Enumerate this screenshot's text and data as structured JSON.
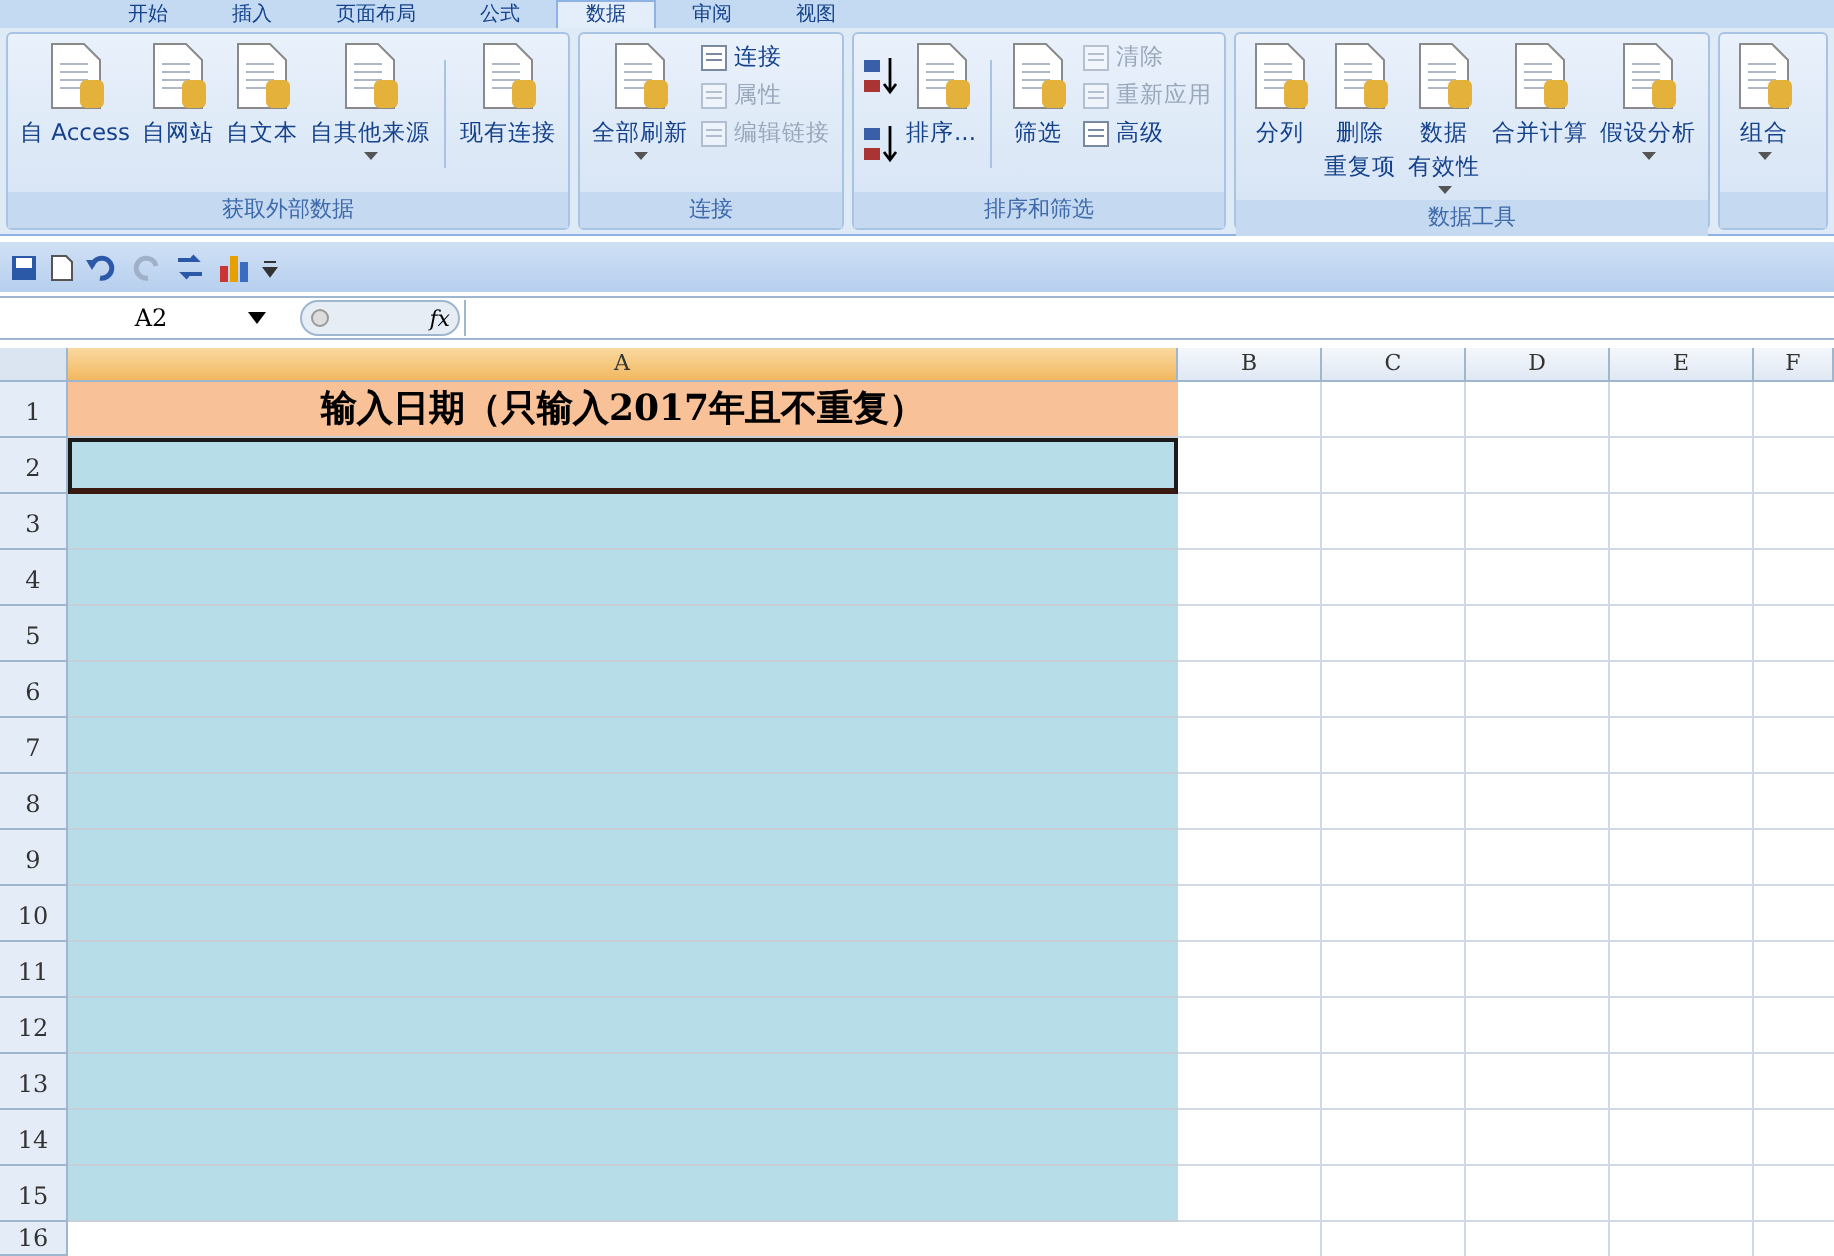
{
  "tabs": [
    {
      "label": "开始",
      "selected": false
    },
    {
      "label": "插入",
      "selected": false
    },
    {
      "label": "页面布局",
      "selected": false
    },
    {
      "label": "公式",
      "selected": false
    },
    {
      "label": "数据",
      "selected": true
    },
    {
      "label": "审阅",
      "selected": false
    },
    {
      "label": "视图",
      "selected": false
    }
  ],
  "ribbon_groups": [
    {
      "title": "获取外部数据",
      "items": [
        {
          "kind": "large",
          "lines": [
            "自 Access"
          ],
          "dropdown": false
        },
        {
          "kind": "large",
          "lines": [
            "自网站"
          ],
          "dropdown": false
        },
        {
          "kind": "large",
          "lines": [
            "自文本"
          ],
          "dropdown": false
        },
        {
          "kind": "large",
          "lines": [
            "自其他来源"
          ],
          "dropdown": true
        },
        {
          "kind": "separator"
        },
        {
          "kind": "large",
          "lines": [
            "现有连接"
          ],
          "dropdown": false
        }
      ]
    },
    {
      "title": "连接",
      "items": [
        {
          "kind": "large",
          "lines": [
            "全部刷新"
          ],
          "dropdown": true
        },
        {
          "kind": "stack",
          "buttons": [
            {
              "label": "连接",
              "disabled": false
            },
            {
              "label": "属性",
              "disabled": true
            },
            {
              "label": "编辑链接",
              "disabled": true
            }
          ]
        }
      ]
    },
    {
      "title": "排序和筛选",
      "items": [
        {
          "kind": "sortpair"
        },
        {
          "kind": "large",
          "lines": [
            "排序..."
          ],
          "dropdown": false
        },
        {
          "kind": "separator"
        },
        {
          "kind": "large",
          "lines": [
            "筛选"
          ],
          "dropdown": false
        },
        {
          "kind": "stack",
          "buttons": [
            {
              "label": "清除",
              "disabled": true
            },
            {
              "label": "重新应用",
              "disabled": true
            },
            {
              "label": "高级",
              "disabled": false
            }
          ]
        }
      ]
    },
    {
      "title": "数据工具",
      "items": [
        {
          "kind": "large",
          "lines": [
            "分列"
          ],
          "dropdown": false
        },
        {
          "kind": "large",
          "lines": [
            "删除",
            "重复项"
          ],
          "dropdown": false
        },
        {
          "kind": "large",
          "lines": [
            "数据",
            "有效性"
          ],
          "dropdown": true
        },
        {
          "kind": "large",
          "lines": [
            "合并计算"
          ],
          "dropdown": false
        },
        {
          "kind": "large",
          "lines": [
            "假设分析"
          ],
          "dropdown": true
        }
      ]
    },
    {
      "items": [
        {
          "kind": "large",
          "lines": [
            "组合"
          ],
          "dropdown": true
        }
      ]
    }
  ],
  "name_box": "A2",
  "fx": "fx",
  "columns": [
    {
      "label": "A",
      "selected": true
    },
    {
      "label": "B",
      "selected": false
    },
    {
      "label": "C",
      "selected": false
    },
    {
      "label": "D",
      "selected": false
    },
    {
      "label": "E",
      "selected": false
    },
    {
      "label": "F",
      "selected": false
    }
  ],
  "rows": [
    {
      "number": "1",
      "cell_a": {
        "text": "输入日期（只输入2017年且不重复）",
        "color": "#f9c197",
        "selected": false
      }
    },
    {
      "number": "2",
      "cell_a": {
        "color": "#b7dde8",
        "selected": true
      }
    },
    {
      "number": "3",
      "cell_a": {
        "color": "#b7dde8",
        "selected": false
      }
    },
    {
      "number": "4",
      "cell_a": {
        "color": "#b7dde8",
        "selected": false
      }
    },
    {
      "number": "5",
      "cell_a": {
        "color": "#b7dde8",
        "selected": false
      }
    },
    {
      "number": "6",
      "cell_a": {
        "color": "#b7dde8",
        "selected": false
      }
    },
    {
      "number": "7",
      "cell_a": {
        "color": "#b7dde8",
        "selected": false
      }
    },
    {
      "number": "8",
      "cell_a": {
        "color": "#b7dde8",
        "selected": false
      }
    },
    {
      "number": "9",
      "cell_a": {
        "color": "#b7dde8",
        "selected": false
      }
    },
    {
      "number": "10",
      "cell_a": {
        "color": "#b7dde8",
        "selected": false
      }
    },
    {
      "number": "11",
      "cell_a": {
        "color": "#b7dde8",
        "selected": false
      }
    },
    {
      "number": "12",
      "cell_a": {
        "color": "#b7dde8",
        "selected": false
      }
    },
    {
      "number": "13",
      "cell_a": {
        "color": "#b7dde8",
        "selected": false
      }
    },
    {
      "number": "14",
      "cell_a": {
        "color": "#b7dde8",
        "selected": false
      }
    },
    {
      "number": "15",
      "cell_a": {
        "color": "#b7dde8",
        "selected": false
      }
    },
    {
      "number": "16"
    }
  ]
}
